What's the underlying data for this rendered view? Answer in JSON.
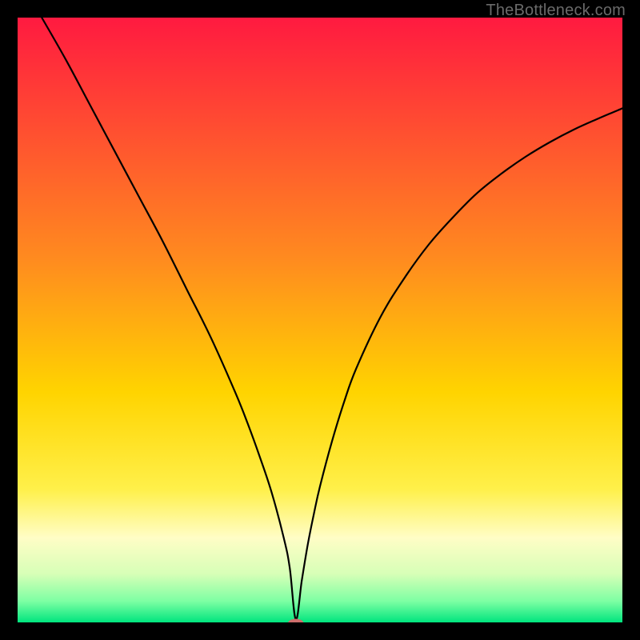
{
  "watermark": "TheBottleneck.com",
  "chart_data": {
    "type": "line",
    "title": "",
    "xlabel": "",
    "ylabel": "",
    "xlim": [
      0,
      100
    ],
    "ylim": [
      0,
      100
    ],
    "legend": null,
    "background_gradient_stops": [
      {
        "offset": 0,
        "color": "#ff1a40"
      },
      {
        "offset": 0.4,
        "color": "#ff8b1f"
      },
      {
        "offset": 0.62,
        "color": "#ffd400"
      },
      {
        "offset": 0.78,
        "color": "#fff04a"
      },
      {
        "offset": 0.86,
        "color": "#fffdc6"
      },
      {
        "offset": 0.92,
        "color": "#d7ffb7"
      },
      {
        "offset": 0.965,
        "color": "#7dffa3"
      },
      {
        "offset": 1.0,
        "color": "#00e57e"
      }
    ],
    "marker": {
      "x": 46,
      "y": 0,
      "color": "#cc6e6b",
      "rx": 10,
      "ry": 6
    },
    "series": [
      {
        "name": "curve",
        "color": "#000000",
        "x": [
          4,
          8,
          12,
          16,
          20,
          24,
          28,
          32,
          36,
          38,
          40,
          42,
          44,
          45,
          46,
          47,
          48,
          49,
          50,
          52,
          54,
          56,
          60,
          64,
          68,
          72,
          76,
          80,
          84,
          88,
          92,
          96,
          100
        ],
        "y": [
          100,
          93,
          85.5,
          78,
          70.5,
          63,
          55,
          47,
          38,
          33,
          27.5,
          21.5,
          14,
          9,
          0.5,
          7,
          13,
          18,
          22.5,
          30,
          36.5,
          42,
          50.5,
          57,
          62.5,
          67,
          71,
          74.2,
          77,
          79.4,
          81.5,
          83.3,
          85
        ]
      }
    ]
  }
}
